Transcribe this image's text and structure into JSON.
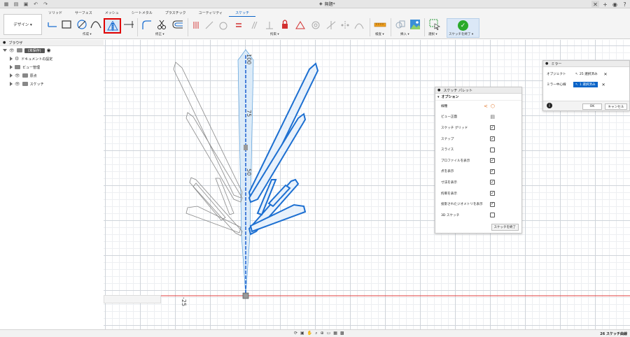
{
  "window": {
    "doc_title": "無題*"
  },
  "ribbon": {
    "tabs": [
      {
        "label": "ソリッド"
      },
      {
        "label": "サーフェス"
      },
      {
        "label": "メッシュ"
      },
      {
        "label": "シートメタル"
      },
      {
        "label": "プラスチック"
      },
      {
        "label": "ユーティリティ"
      },
      {
        "label": "スケッチ"
      }
    ],
    "active_tab": "スケッチ",
    "design_button": "デザイン ▾",
    "groups": {
      "create": "作成 ▾",
      "modify": "修正 ▾",
      "constraints": "拘束 ▾",
      "inspect": "検査 ▾",
      "insert": "挿入 ▾",
      "select": "選択 ▾",
      "finish": "スケッチを終了 ▾"
    },
    "highlighted_tool": "mirror-icon",
    "accent": "#0a64c8"
  },
  "browser": {
    "title": "ブラウザ",
    "root_label": "(未保存)",
    "items": [
      {
        "label": "ドキュメントの設定",
        "icon": "gear-icon"
      },
      {
        "label": "ビュー管理",
        "icon": "folder-icon"
      },
      {
        "label": "原点",
        "icon": "folder-icon"
      },
      {
        "label": "スケッチ",
        "icon": "folder-icon"
      }
    ]
  },
  "canvas": {
    "axis_labels": [
      "100",
      "75",
      "50",
      "-25"
    ]
  },
  "sketch_palette": {
    "title": "スケッチ パレット",
    "section": "オプション",
    "rows": [
      {
        "label": "線種",
        "control": "linetype"
      },
      {
        "label": "ビュー正面",
        "control": "view"
      },
      {
        "label": "スケッチ グリッド",
        "checked": true
      },
      {
        "label": "スナップ",
        "checked": true
      },
      {
        "label": "スライス",
        "checked": false
      },
      {
        "label": "プロファイルを表示",
        "checked": true
      },
      {
        "label": "点を表示",
        "checked": true
      },
      {
        "label": "寸法を表示",
        "checked": true
      },
      {
        "label": "拘束を表示",
        "checked": true
      },
      {
        "label": "投影されたジオメトリを表示",
        "checked": true
      },
      {
        "label": "3D スケッチ",
        "checked": false
      }
    ],
    "finish_button": "スケッチを終了"
  },
  "mirror_dialog": {
    "title": "ミラー",
    "object_label": "オブジェクト",
    "object_value": "25 選択済み",
    "line_label": "ミラー中心線",
    "line_value": "1 選択済み",
    "ok": "OK",
    "cancel": "キャンセル"
  },
  "status": {
    "text": "26 スケッチ曲線"
  }
}
